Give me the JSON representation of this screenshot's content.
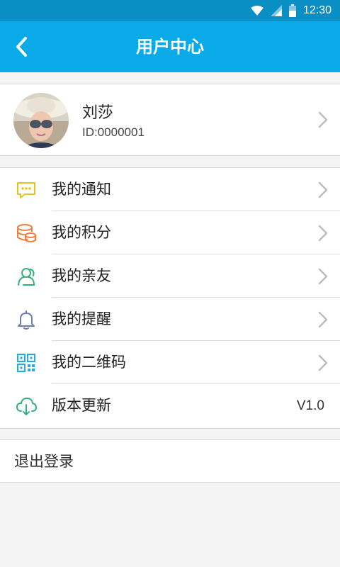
{
  "status_bar": {
    "time": "12:30"
  },
  "header": {
    "title": "用户中心"
  },
  "profile": {
    "name": "刘莎",
    "id_text": "ID:0000001"
  },
  "menu": {
    "items": [
      {
        "label": "我的通知",
        "icon": "message-icon",
        "color": "#e6c21a"
      },
      {
        "label": "我的积分",
        "icon": "coins-icon",
        "color": "#f07f3c"
      },
      {
        "label": "我的亲友",
        "icon": "friends-icon",
        "color": "#35b27a"
      },
      {
        "label": "我的提醒",
        "icon": "bell-icon",
        "color": "#6c7fb3"
      },
      {
        "label": "我的二维码",
        "icon": "qr-code-icon",
        "color": "#27a9e1"
      },
      {
        "label": "版本更新",
        "icon": "cloud-download-icon",
        "color": "#35b27a"
      }
    ],
    "version": "V1.0"
  },
  "logout": {
    "label": "退出登录"
  },
  "colors": {
    "header": "#0aa9e8",
    "status_bar": "#0a8fc4",
    "background": "#f4f4f4"
  }
}
